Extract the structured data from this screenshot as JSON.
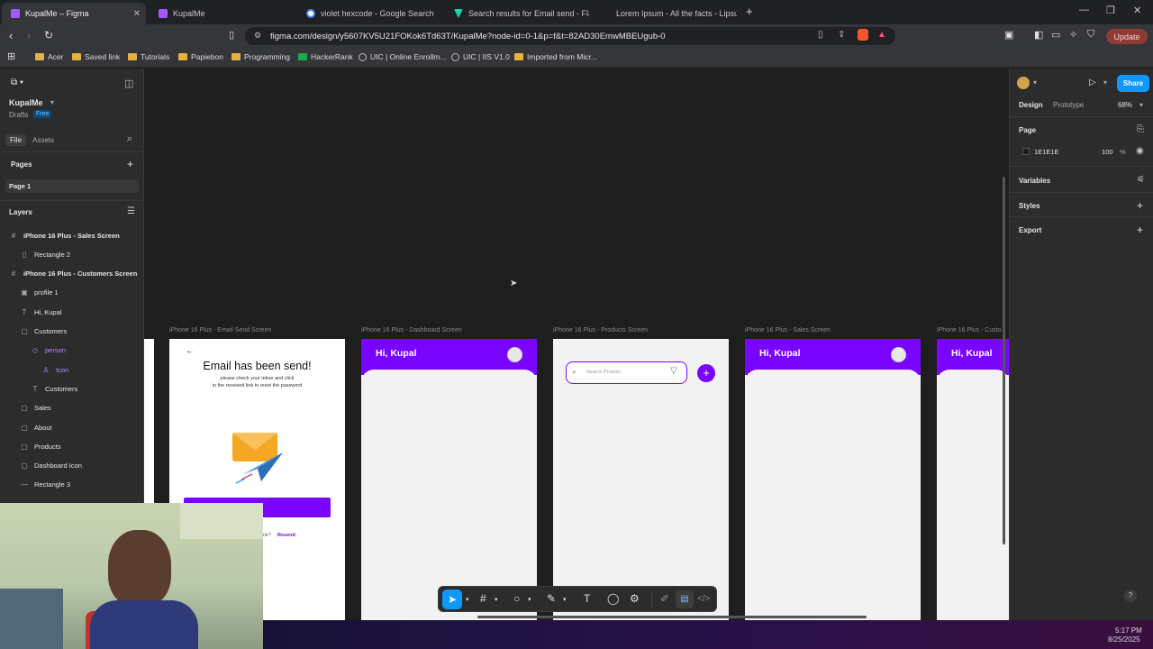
{
  "browser": {
    "tabs": [
      {
        "label": "KupalMe – Figma",
        "active": true,
        "color": "#a259ff"
      },
      {
        "label": "KupalMe",
        "active": false,
        "color": "#a259ff"
      },
      {
        "label": "violet hexcode - Google Search",
        "active": false,
        "color": "#4285f4"
      },
      {
        "label": "Search results for Email send - Flatic",
        "active": false,
        "color": "#1fd1a5"
      },
      {
        "label": "Lorem Ipsum - All the facts - Lipsum",
        "active": false,
        "color": "#777777"
      }
    ],
    "new_tab": "+",
    "url": "figma.com/design/y5607KV5U21FOKok6Td63T/KupalMe?node-id=0-1&p=f&t=82AD30EmwMBEUgub-0",
    "update_label": "Update",
    "bookmarks": [
      {
        "label": "Acer",
        "kind": "folder"
      },
      {
        "label": "Saved link",
        "kind": "folder"
      },
      {
        "label": "Tutorials",
        "kind": "folder"
      },
      {
        "label": "Papiebon",
        "kind": "folder"
      },
      {
        "label": "Programming",
        "kind": "folder"
      },
      {
        "label": "HackerRank",
        "kind": "site"
      },
      {
        "label": "UIC | Online Enrollm...",
        "kind": "site"
      },
      {
        "label": "UIC | IIS V1.0",
        "kind": "site"
      },
      {
        "label": "Imported from Micr...",
        "kind": "folder"
      }
    ]
  },
  "figma": {
    "file_name": "KupalMe",
    "drafts_label": "Drafts",
    "plan_badge": "Free",
    "left_tabs": {
      "file": "File",
      "assets": "Assets"
    },
    "pages_heading": "Pages",
    "pages": [
      "Page 1"
    ],
    "layers_heading": "Layers",
    "layers": [
      {
        "label": "iPhone 16 Plus - Sales Screen",
        "icon": "#",
        "indent": 0,
        "bold": true
      },
      {
        "label": "Rectangle 2",
        "icon": "▯",
        "indent": 1,
        "bold": false
      },
      {
        "label": "iPhone 16 Plus - Customers Screen",
        "icon": "#",
        "indent": 0,
        "bold": true
      },
      {
        "label": "profile 1",
        "icon": "▣",
        "indent": 1,
        "bold": false
      },
      {
        "label": "Hi, Kupal",
        "icon": "T",
        "indent": 1,
        "bold": false
      },
      {
        "label": "Customers",
        "icon": "▢",
        "indent": 1,
        "bold": false
      },
      {
        "label": "person",
        "icon": "◇",
        "indent": 2,
        "bold": false,
        "purple": true
      },
      {
        "label": "Icon",
        "icon": "♙",
        "indent": 3,
        "bold": false,
        "purple": true
      },
      {
        "label": "Customers",
        "icon": "T",
        "indent": 2,
        "bold": false
      },
      {
        "label": "Sales",
        "icon": "▢",
        "indent": 1,
        "bold": false
      },
      {
        "label": "About",
        "icon": "▢",
        "indent": 1,
        "bold": false
      },
      {
        "label": "Products",
        "icon": "▢",
        "indent": 1,
        "bold": false
      },
      {
        "label": "Dashboard Icon",
        "icon": "▢",
        "indent": 1,
        "bold": false
      },
      {
        "label": "Rectangle 3",
        "icon": "—",
        "indent": 1,
        "bold": false
      }
    ],
    "frames": [
      {
        "label": "iPhone 16 Plus - Email Send Screen"
      },
      {
        "label": "iPhone 16 Plus - Dashboard Screen"
      },
      {
        "label": "iPhone 16 Plus - Products Screen"
      },
      {
        "label": "iPhone 16 Plus - Sales Screen"
      },
      {
        "label": "iPhone 16 Plus - Custo"
      }
    ],
    "email_screen": {
      "back": "←",
      "title": "Email has been send!",
      "line1": "please check your inbox and click",
      "line2": "in the received link to reset the password",
      "resend_prefix": "nk?",
      "resend": "Resend"
    },
    "greeting": "Hi, Kupal",
    "products_screen": {
      "search_placeholder": "Search Product",
      "add": "+"
    },
    "right_tabs": {
      "design": "Design",
      "prototype": "Prototype",
      "zoom": "68%"
    },
    "share_label": "Share",
    "page_section": {
      "heading": "Page",
      "color_hex": "1E1E1E",
      "opacity": "100",
      "percent": "%"
    },
    "sections": [
      "Variables",
      "Styles",
      "Export"
    ],
    "accent": "#7a05ff",
    "share_color": "#0d99ff"
  },
  "system": {
    "time": "5:17 PM",
    "date": "8/25/2025",
    "help": "?"
  }
}
